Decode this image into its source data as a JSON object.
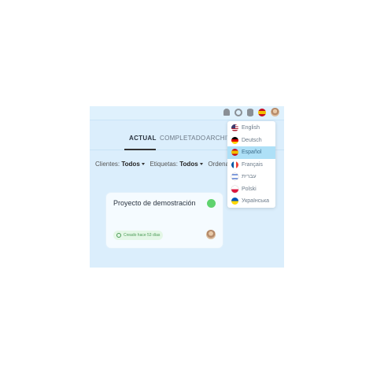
{
  "tabs": {
    "actual": "ACTUAL",
    "completado": "COMPLETADO",
    "archivo": "ARCHIVO"
  },
  "filters": {
    "clientes_label": "Clientes:",
    "clientes_value": "Todos",
    "etiquetas_label": "Etiquetas:",
    "etiquetas_value": "Todos",
    "ordenar_label": "Ordenar po"
  },
  "card": {
    "title": "Proyecto de demostración",
    "created": "Creado hace 53 días",
    "status_color": "#5fd36e"
  },
  "top_icons": [
    "bell-icon",
    "gear-icon",
    "database-icon",
    "spain-flag-icon",
    "user-avatar"
  ],
  "languages": [
    {
      "label": "English",
      "flag": "us-flag-icon",
      "selected": false
    },
    {
      "label": "Deutsch",
      "flag": "germany-flag-icon",
      "selected": false
    },
    {
      "label": "Español",
      "flag": "spain-flag-icon",
      "selected": true
    },
    {
      "label": "Français",
      "flag": "france-flag-icon",
      "selected": false
    },
    {
      "label": "עברית",
      "flag": "israel-flag-icon",
      "selected": false
    },
    {
      "label": "Polski",
      "flag": "poland-flag-icon",
      "selected": false
    },
    {
      "label": "Українська",
      "flag": "ukraine-flag-icon",
      "selected": false
    }
  ],
  "colors": {
    "accent": "#aee0f7",
    "app_bg": "#dbeefc"
  }
}
